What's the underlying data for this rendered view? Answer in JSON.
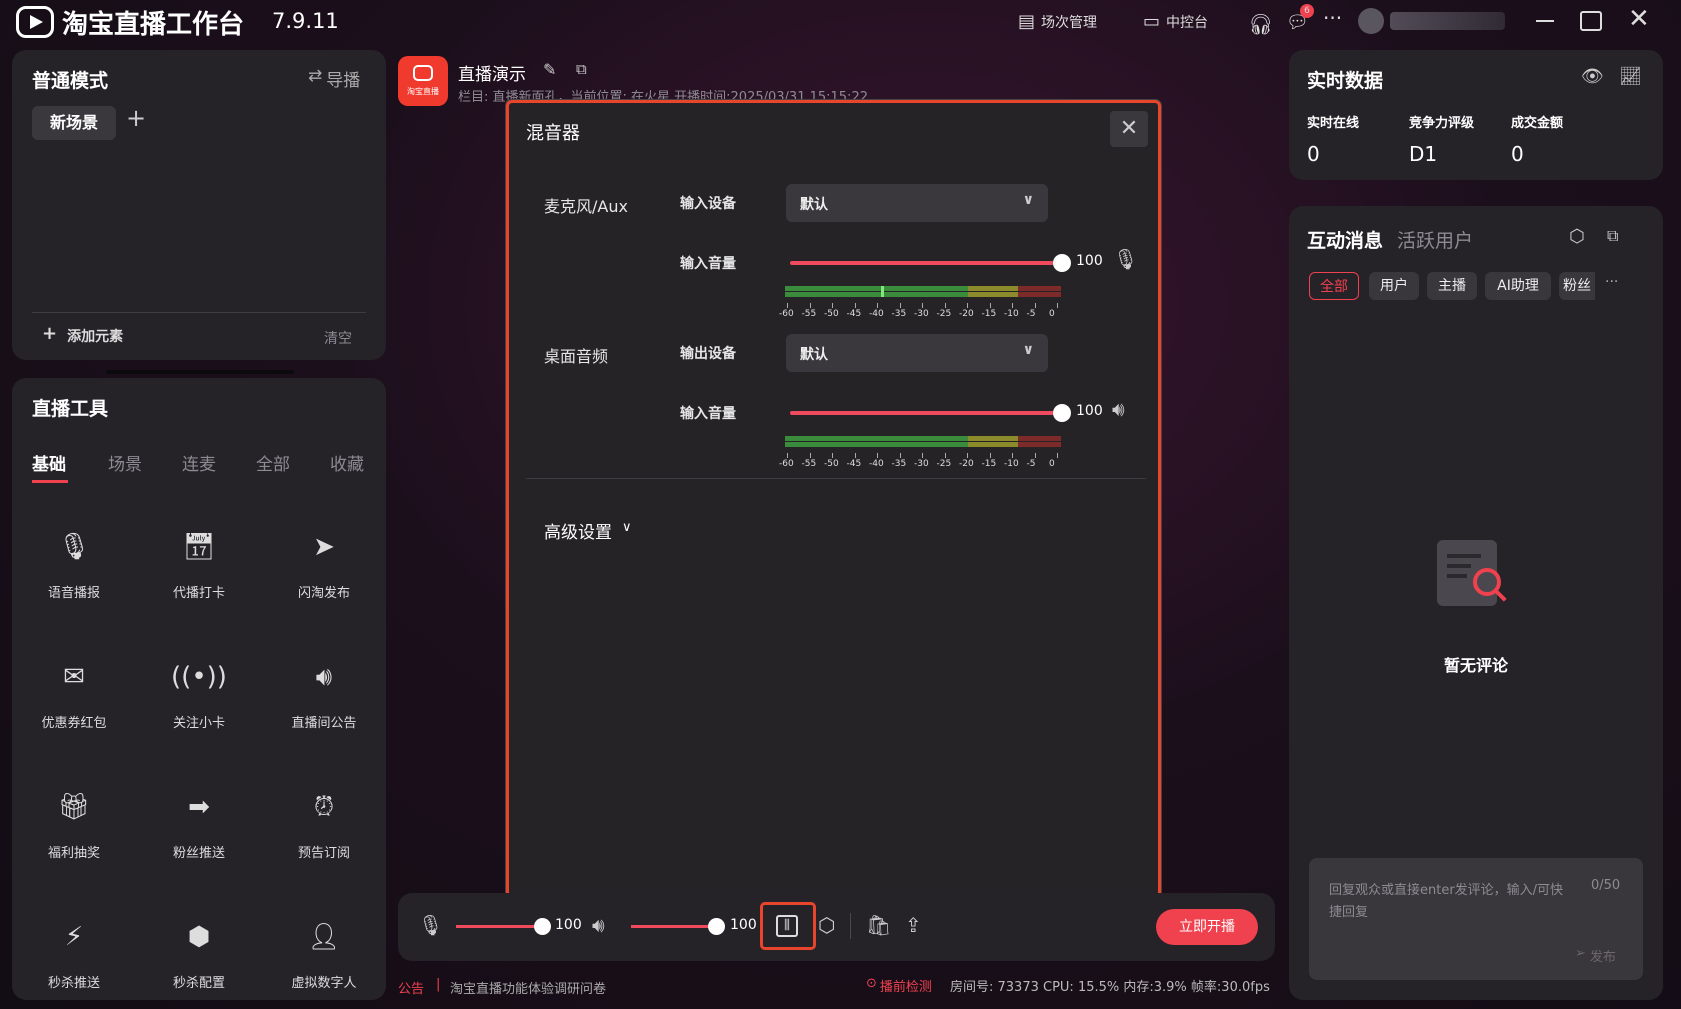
{
  "app": {
    "title": "淘宝直播工作台",
    "version": "7.9.11"
  },
  "titlebar": {
    "session_label": "场次管理",
    "console_label": "中控台",
    "message_badge": "6"
  },
  "scene": {
    "title": "普通模式",
    "guide_label": "导播",
    "active_scene": "新场景",
    "add_element_label": "添加元素",
    "clear_label": "清空"
  },
  "tools": {
    "title": "直播工具",
    "tabs": [
      "基础",
      "场景",
      "连麦",
      "全部",
      "收藏"
    ],
    "items": [
      {
        "label": "语音播报",
        "icon": "microphone-icon"
      },
      {
        "label": "代播打卡",
        "icon": "calendar-check-icon"
      },
      {
        "label": "闪淘发布",
        "icon": "paper-plane-icon"
      },
      {
        "label": "优惠券红包",
        "icon": "red-packet-icon"
      },
      {
        "label": "关注小卡",
        "icon": "broadcast-icon"
      },
      {
        "label": "直播间公告",
        "icon": "speaker-icon"
      },
      {
        "label": "福利抽奖",
        "icon": "gift-icon"
      },
      {
        "label": "粉丝推送",
        "icon": "push-arrow-icon"
      },
      {
        "label": "预告订阅",
        "icon": "alarm-clock-icon"
      },
      {
        "label": "秒杀推送",
        "icon": "flash-sale-icon"
      },
      {
        "label": "秒杀配置",
        "icon": "flash-config-icon"
      },
      {
        "label": "虚拟数字人",
        "icon": "avatar-person-icon"
      }
    ]
  },
  "stream": {
    "logo_label": "淘宝直播",
    "title": "直播演示",
    "meta": "栏目: 直播新面孔，当前位置: 在火星  开播时间:2025/03/31 15:15:22"
  },
  "mixer": {
    "title": "混音器",
    "mic": {
      "section": "麦克风/Aux",
      "device_label": "输入设备",
      "device_value": "默认",
      "volume_label": "输入音量",
      "volume": 100
    },
    "desktop": {
      "section": "桌面音频",
      "device_label": "输出设备",
      "device_value": "默认",
      "volume_label": "输入音量",
      "volume": 100
    },
    "scale": [
      "-60",
      "-55",
      "-50",
      "-45",
      "-40",
      "-35",
      "-30",
      "-25",
      "-20",
      "-15",
      "-10",
      "-5",
      "0"
    ],
    "advanced_label": "高级设置"
  },
  "bottom": {
    "mic_volume": "100",
    "speaker_volume": "100",
    "start_label": "立即开播"
  },
  "status": {
    "notice_tag": "公告",
    "notice_text": "淘宝直播功能体验调研问卷",
    "check_label": "播前检测",
    "stats": "房间号: 73373 CPU: 15.5% 内存:3.9% 帧率:30.0fps"
  },
  "realtime": {
    "title": "实时数据",
    "metrics": [
      {
        "label": "实时在线",
        "value": "0"
      },
      {
        "label": "竞争力评级",
        "value": "D1"
      },
      {
        "label": "成交金额",
        "value": "0"
      }
    ]
  },
  "interaction": {
    "title": "互动消息",
    "subtitle": "活跃用户",
    "tabs": [
      "全部",
      "用户",
      "主播",
      "AI助理",
      "粉丝"
    ],
    "more": "···",
    "empty": "暂无评论",
    "reply_placeholder": "回复观众或直接enter发评论，输入/可快捷回复",
    "count": "0/50",
    "send_label": "发布"
  },
  "colors": {
    "accent": "#f0414f",
    "highlight": "#e8452c"
  }
}
